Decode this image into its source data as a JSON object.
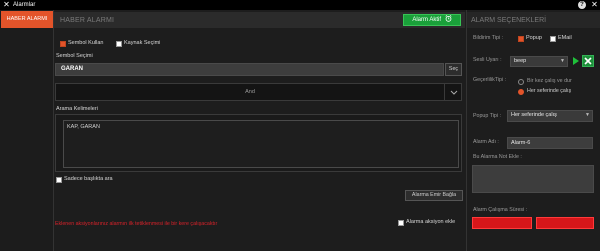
{
  "window": {
    "title": "Alarmlar",
    "close_glyph": "✕",
    "help_glyph": "?",
    "close2_glyph": "✕"
  },
  "sidebar": {
    "active_tab": "HABER ALARMI"
  },
  "main": {
    "header_title": "HABER ALARMI",
    "alarm_aktif_label": "Alarm Aktif",
    "sembol_kullan_label": "Sembol Kullan",
    "sembol_kullan_checked": true,
    "kaynak_secimi_label": "Kaynak Seçimi",
    "kaynak_secimi_checked": false,
    "sembol_secimi_label": "Sembol Seçimi",
    "sembol_value": "GARAN",
    "sec_button_label": "Seç",
    "and_label": "And",
    "arama_kelimeleri_label": "Arama Kelimeleri",
    "keywords_value": "KAP, GARAN",
    "sadece_baslikta_label": "Sadece başlıkta ara",
    "alarma_emir_bagla_label": "Alarma Emir Bağla",
    "warning_text": "Eklenen aksiyonlarınız alarmın ilk tetiklenmesi ile bir kere çalışacaktır",
    "alarma_aksiyon_ekle_label": "Alarma aksiyon ekle"
  },
  "right": {
    "header_title": "ALARM SEÇENEKLERİ",
    "bildirim_tipi_label": "Bildirim Tipi :",
    "popup_label": "Popup",
    "popup_checked": true,
    "email_label": "EMail",
    "email_checked": false,
    "sesli_uyari_label": "Sesli Uyarı :",
    "sesli_uyari_value": "beep",
    "gecerlilik_label": "GeçerlilikTipi :",
    "gecerlilik_options": [
      "Bir kez çalış ve dur",
      "Her seferinde çalış"
    ],
    "gecerlilik_selected": 1,
    "popup_tipi_label": "Popup Tipi :",
    "popup_tipi_value": "Her seferinde çalış",
    "alarm_adi_label": "Alarm Adı :",
    "alarm_adi_value": "Alarm-6",
    "not_ekle_label": "Bu Alarma Not Ekle :",
    "calisma_suresi_label": "Alarm Çalışma Süresi :"
  },
  "colors": {
    "accent": "#e3542a",
    "green": "#1aa03a",
    "red": "#d6161a",
    "warning": "#d9222a"
  }
}
